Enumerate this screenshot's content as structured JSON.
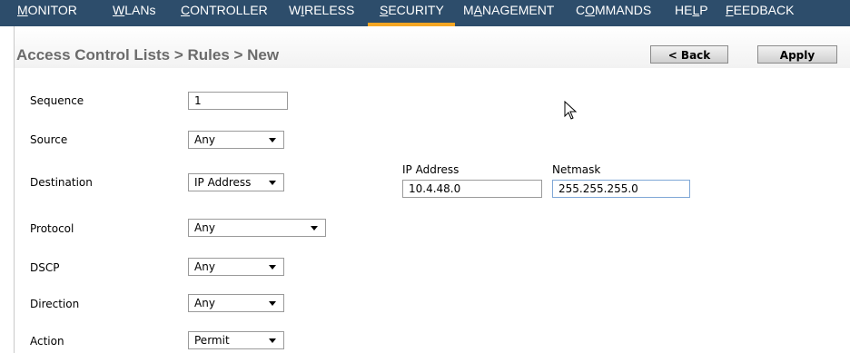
{
  "nav": {
    "items": [
      {
        "pre": "",
        "ul": "M",
        "post": "ONITOR"
      },
      {
        "pre": "",
        "ul": "W",
        "post": "LANs"
      },
      {
        "pre": "",
        "ul": "C",
        "post": "ONTROLLER"
      },
      {
        "pre": "W",
        "ul": "I",
        "post": "RELESS"
      },
      {
        "pre": "",
        "ul": "S",
        "post": "ECURITY"
      },
      {
        "pre": "M",
        "ul": "A",
        "post": "NAGEMENT"
      },
      {
        "pre": "C",
        "ul": "O",
        "post": "MMANDS"
      },
      {
        "pre": "HE",
        "ul": "L",
        "post": "P"
      },
      {
        "pre": "",
        "ul": "F",
        "post": "EEDBACK"
      }
    ],
    "active_color": "#f5a623"
  },
  "page": {
    "title": "Access Control Lists > Rules > New",
    "back_label": "< Back",
    "apply_label": "Apply"
  },
  "form": {
    "sequence": {
      "label": "Sequence",
      "value": "1"
    },
    "source": {
      "label": "Source",
      "value": "Any"
    },
    "destination": {
      "label": "Destination",
      "value": "IP Address",
      "ip_label": "IP Address",
      "ip_value": "10.4.48.0",
      "netmask_label": "Netmask",
      "netmask_value": "255.255.255.0"
    },
    "protocol": {
      "label": "Protocol",
      "value": "Any"
    },
    "dscp": {
      "label": "DSCP",
      "value": "Any"
    },
    "direction": {
      "label": "Direction",
      "value": "Any"
    },
    "action": {
      "label": "Action",
      "value": "Permit"
    }
  },
  "colors": {
    "nav_bg": "#2d4d6b",
    "title_text": "#6b6b6b"
  }
}
